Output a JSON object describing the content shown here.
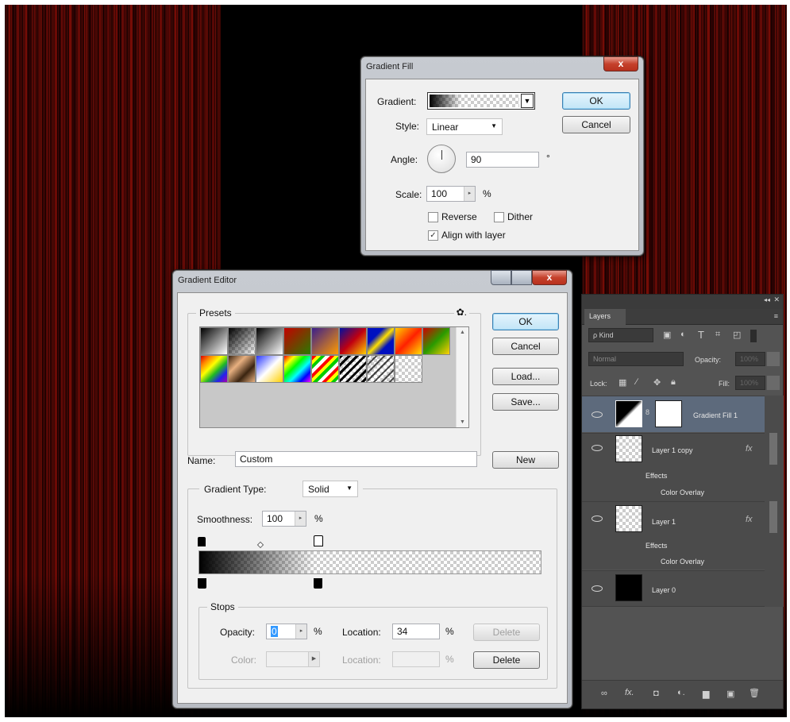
{
  "gradient_fill": {
    "title": "Gradient Fill",
    "close": "x",
    "gradient_label": "Gradient:",
    "style_label": "Style:",
    "style_value": "Linear",
    "angle_label": "Angle:",
    "angle_value": "90",
    "degree": "°",
    "scale_label": "Scale:",
    "scale_value": "100",
    "percent": "%",
    "reverse": "Reverse",
    "dither": "Dither",
    "align": "Align with layer",
    "ok": "OK",
    "cancel": "Cancel"
  },
  "gradient_editor": {
    "title": "Gradient Editor",
    "close": "x",
    "presets_label": "Presets",
    "gear": "✿.",
    "ok": "OK",
    "cancel": "Cancel",
    "load": "Load...",
    "save": "Save...",
    "name_label": "Name:",
    "name_value": "Custom",
    "new": "New",
    "type_label": "Gradient Type:",
    "type_value": "Solid",
    "smoothness_label": "Smoothness:",
    "smoothness_value": "100",
    "percent": "%",
    "stops_label": "Stops",
    "opacity_label": "Opacity:",
    "opacity_value": "0",
    "location_label": "Location:",
    "location_value": "34",
    "delete": "Delete",
    "color_label": "Color:",
    "location2_label": "Location:"
  },
  "layers": {
    "tab": "Layers",
    "kind": "ρ Kind",
    "blend": "Normal",
    "opacity_label": "Opacity:",
    "opacity_value": "100%",
    "lock_label": "Lock:",
    "fill_label": "Fill:",
    "fill_value": "100%",
    "items": [
      {
        "name": "Gradient Fill 1"
      },
      {
        "name": "Layer 1 copy",
        "fx": "fx",
        "effects": "Effects",
        "overlay": "Color Overlay"
      },
      {
        "name": "Layer 1",
        "fx": "fx",
        "effects": "Effects",
        "overlay": "Color Overlay"
      },
      {
        "name": "Layer 0"
      }
    ],
    "footer": [
      "∞",
      "fx.",
      "◘",
      "◐.",
      "▆",
      "▣",
      "🗑"
    ]
  }
}
